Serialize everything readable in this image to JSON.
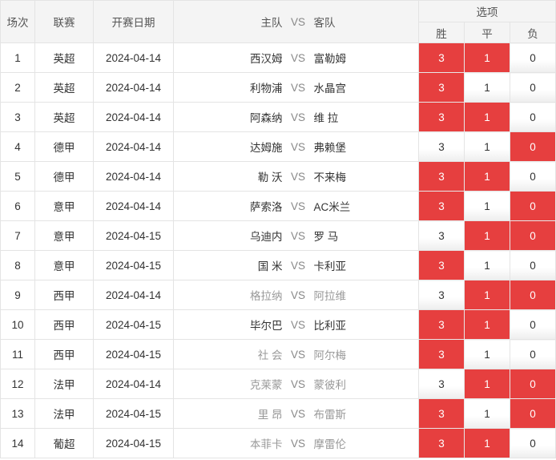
{
  "header": {
    "round": "场次",
    "league": "联赛",
    "date": "开赛日期",
    "home": "主队",
    "vs": "VS",
    "away": "客队",
    "options": "选项",
    "win": "胜",
    "draw": "平",
    "lose": "负"
  },
  "colors": {
    "selected": "#e63f3f",
    "muted_text": "#999999"
  },
  "matches": [
    {
      "no": "1",
      "league": "英超",
      "date": "2024-04-14",
      "home": "西汉姆",
      "away": "富勒姆",
      "muted": false,
      "win": "3",
      "draw": "1",
      "lose": "0",
      "win_on": true,
      "draw_on": true,
      "lose_on": false
    },
    {
      "no": "2",
      "league": "英超",
      "date": "2024-04-14",
      "home": "利物浦",
      "away": "水晶宫",
      "muted": false,
      "win": "3",
      "draw": "1",
      "lose": "0",
      "win_on": true,
      "draw_on": false,
      "lose_on": false
    },
    {
      "no": "3",
      "league": "英超",
      "date": "2024-04-14",
      "home": "阿森纳",
      "away": "维 拉",
      "muted": false,
      "win": "3",
      "draw": "1",
      "lose": "0",
      "win_on": true,
      "draw_on": true,
      "lose_on": false
    },
    {
      "no": "4",
      "league": "德甲",
      "date": "2024-04-14",
      "home": "达姆施",
      "away": "弗赖堡",
      "muted": false,
      "win": "3",
      "draw": "1",
      "lose": "0",
      "win_on": false,
      "draw_on": false,
      "lose_on": true
    },
    {
      "no": "5",
      "league": "德甲",
      "date": "2024-04-14",
      "home": "勒 沃",
      "away": "不来梅",
      "muted": false,
      "win": "3",
      "draw": "1",
      "lose": "0",
      "win_on": true,
      "draw_on": true,
      "lose_on": false
    },
    {
      "no": "6",
      "league": "意甲",
      "date": "2024-04-14",
      "home": "萨索洛",
      "away": "AC米兰",
      "muted": false,
      "win": "3",
      "draw": "1",
      "lose": "0",
      "win_on": true,
      "draw_on": false,
      "lose_on": true
    },
    {
      "no": "7",
      "league": "意甲",
      "date": "2024-04-15",
      "home": "乌迪内",
      "away": "罗 马",
      "muted": false,
      "win": "3",
      "draw": "1",
      "lose": "0",
      "win_on": false,
      "draw_on": true,
      "lose_on": true
    },
    {
      "no": "8",
      "league": "意甲",
      "date": "2024-04-15",
      "home": "国 米",
      "away": "卡利亚",
      "muted": false,
      "win": "3",
      "draw": "1",
      "lose": "0",
      "win_on": true,
      "draw_on": false,
      "lose_on": false
    },
    {
      "no": "9",
      "league": "西甲",
      "date": "2024-04-14",
      "home": "格拉纳",
      "away": "阿拉维",
      "muted": true,
      "win": "3",
      "draw": "1",
      "lose": "0",
      "win_on": false,
      "draw_on": true,
      "lose_on": true
    },
    {
      "no": "10",
      "league": "西甲",
      "date": "2024-04-15",
      "home": "毕尔巴",
      "away": "比利亚",
      "muted": false,
      "win": "3",
      "draw": "1",
      "lose": "0",
      "win_on": true,
      "draw_on": true,
      "lose_on": false
    },
    {
      "no": "11",
      "league": "西甲",
      "date": "2024-04-15",
      "home": "社 会",
      "away": "阿尔梅",
      "muted": true,
      "win": "3",
      "draw": "1",
      "lose": "0",
      "win_on": true,
      "draw_on": false,
      "lose_on": false
    },
    {
      "no": "12",
      "league": "法甲",
      "date": "2024-04-14",
      "home": "克莱蒙",
      "away": "蒙彼利",
      "muted": true,
      "win": "3",
      "draw": "1",
      "lose": "0",
      "win_on": false,
      "draw_on": true,
      "lose_on": true
    },
    {
      "no": "13",
      "league": "法甲",
      "date": "2024-04-15",
      "home": "里 昂",
      "away": "布雷斯",
      "muted": true,
      "win": "3",
      "draw": "1",
      "lose": "0",
      "win_on": true,
      "draw_on": false,
      "lose_on": true
    },
    {
      "no": "14",
      "league": "葡超",
      "date": "2024-04-15",
      "home": "本菲卡",
      "away": "摩雷伦",
      "muted": true,
      "win": "3",
      "draw": "1",
      "lose": "0",
      "win_on": true,
      "draw_on": true,
      "lose_on": false
    }
  ]
}
